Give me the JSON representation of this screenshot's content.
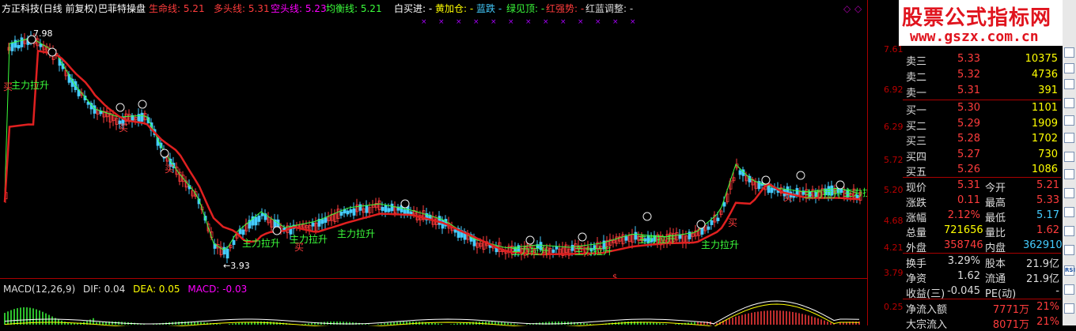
{
  "title": {
    "stock": "方正科技(日线 前复权)",
    "indicator": "巴菲特操盘",
    "items": [
      {
        "label": "生命线:",
        "value": "5.21",
        "color": "#ff3c3c"
      },
      {
        "label": "多头线:",
        "value": "5.31",
        "color": "#ff3c3c"
      },
      {
        "label": "空头线:",
        "value": "5.23",
        "color": "#f0f"
      },
      {
        "label": "均衡线:",
        "value": "5.21",
        "color": "#3cff3c"
      }
    ],
    "signals": [
      {
        "label": "白买进:",
        "value": "-",
        "color": "#fff"
      },
      {
        "label": "黄加仓:",
        "value": "-",
        "color": "#ff0"
      },
      {
        "label": "蓝跌",
        "value": "-",
        "color": "#4cf"
      },
      {
        "label": "绿见顶:",
        "value": "-",
        "color": "#3cff3c"
      },
      {
        "label": "红强势:",
        "value": "-",
        "color": "#ff3c3c"
      },
      {
        "label": "红蓝调整:",
        "value": "-",
        "color": "#ddd"
      }
    ]
  },
  "watermark": {
    "line1": "股票公式指标网",
    "line2": "www.gszx.com.cn"
  },
  "price_axis": [
    "7.61",
    "6.92",
    "6.29",
    "5.72",
    "5.20",
    "4.68",
    "4.21",
    "3.79",
    "0.25"
  ],
  "annotations": {
    "high_label": "7.98",
    "low_label": "←3.93",
    "buy_text": "买",
    "buy_tag": "主力拉升",
    "dollar": "$"
  },
  "macd": {
    "label": "MACD(12,26,9)",
    "dif": "DIF: 0.04",
    "dea": "DEA: 0.05",
    "macd": "MACD: -0.03"
  },
  "quote": {
    "sell": [
      {
        "label": "卖三",
        "price": "5.33",
        "vol": "10375"
      },
      {
        "label": "卖二",
        "price": "5.32",
        "vol": "4736"
      },
      {
        "label": "卖一",
        "price": "5.31",
        "vol": "391"
      }
    ],
    "buy": [
      {
        "label": "买一",
        "price": "5.30",
        "vol": "1101"
      },
      {
        "label": "买二",
        "price": "5.29",
        "vol": "1909"
      },
      {
        "label": "买三",
        "price": "5.28",
        "vol": "1702"
      },
      {
        "label": "买四",
        "price": "5.27",
        "vol": "730"
      },
      {
        "label": "买五",
        "price": "5.26",
        "vol": "1086"
      }
    ],
    "stats1": [
      {
        "l1": "现价",
        "v1": "5.31",
        "c1": "#ff3c3c",
        "l2": "今开",
        "v2": "5.21",
        "c2": "#ff3c3c"
      },
      {
        "l1": "涨跌",
        "v1": "0.11",
        "c1": "#ff3c3c",
        "l2": "最高",
        "v2": "5.33",
        "c2": "#ff3c3c"
      },
      {
        "l1": "涨幅",
        "v1": "2.12%",
        "c1": "#ff3c3c",
        "l2": "最低",
        "v2": "5.17",
        "c2": "#4cf"
      },
      {
        "l1": "总量",
        "v1": "721656",
        "c1": "#ff0",
        "l2": "量比",
        "v2": "1.62",
        "c2": "#ff3c3c"
      },
      {
        "l1": "外盘",
        "v1": "358746",
        "c1": "#ff3c3c",
        "l2": "内盘",
        "v2": "362910",
        "c2": "#4cf"
      }
    ],
    "stats2": [
      {
        "l1": "换手",
        "v1": "3.29%",
        "c1": "#ddd",
        "l2": "股本",
        "v2": "21.9亿",
        "c2": "#ddd"
      },
      {
        "l1": "净资",
        "v1": "1.62",
        "c1": "#ddd",
        "l2": "流通",
        "v2": "21.9亿",
        "c2": "#ddd"
      },
      {
        "l1": "收益(三)",
        "v1": "-0.045",
        "c1": "#ddd",
        "l2": "PE(动)",
        "v2": "-",
        "c2": "#ddd"
      }
    ],
    "flow": [
      {
        "label": "净流入额",
        "value": "7771万",
        "pct": "21%"
      },
      {
        "label": "大宗流入",
        "value": "8071万",
        "pct": "21%"
      }
    ]
  },
  "toolbar": {
    "rsi_label": "RSI"
  },
  "colors": {
    "up": "#ff3c3c",
    "down": "#4cf",
    "life_line": "#e02020",
    "fast_line": "#3cff3c",
    "axis": "#a00000"
  }
}
